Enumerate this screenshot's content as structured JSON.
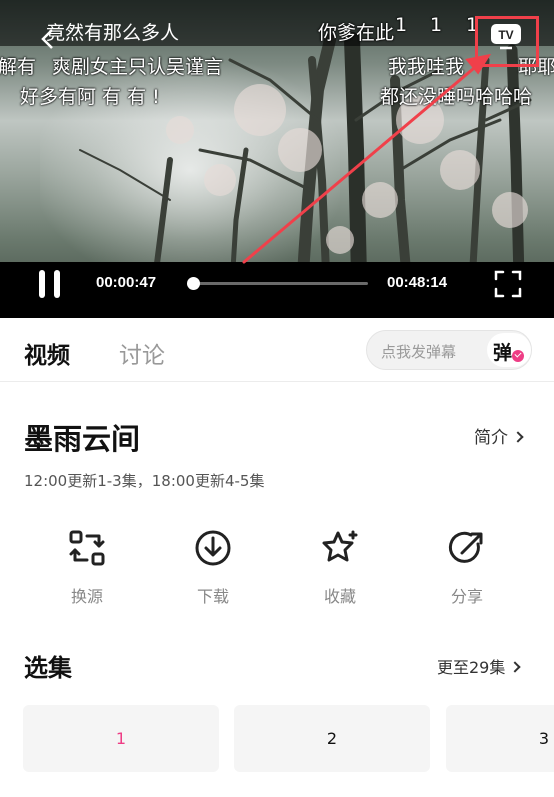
{
  "player": {
    "title": "竟然有那么多人",
    "top_right_text": "你爹在此",
    "top_digits": [
      "1",
      "1"
    ],
    "danmaku_lines": [
      "解有",
      "爽剧女主只认吴谨言",
      "我我哇我",
      "耶耶",
      "好多有阿 有 有 !",
      "都还没睡吗哈哈哈"
    ],
    "current_time": "00:00:47",
    "total_time": "00:48:14",
    "progress_fraction": 0.016,
    "icons": {
      "back": "chevron-left-icon",
      "cast": "tv-cast-icon",
      "pause": "pause-icon",
      "fullscreen": "fullscreen-icon"
    }
  },
  "annotation": {
    "color": "#f0404a"
  },
  "tabs": [
    {
      "label": "视频",
      "active": true
    },
    {
      "label": "讨论",
      "active": false
    }
  ],
  "danmaku_input": {
    "placeholder": "点我发弹幕",
    "toggle_label": "弹",
    "toggle_on": true
  },
  "show": {
    "title": "墨雨云间",
    "intro_label": "简介",
    "update_note": "12:00更新1-3集，18:00更新4-5集"
  },
  "actions": [
    {
      "label": "换源",
      "icon": "switch-source-icon"
    },
    {
      "label": "下载",
      "icon": "download-icon"
    },
    {
      "label": "收藏",
      "icon": "star-icon"
    },
    {
      "label": "分享",
      "icon": "share-icon"
    }
  ],
  "episodes_section": {
    "title": "选集",
    "more_label": "更至29集",
    "episodes": [
      {
        "label": "1",
        "active": true
      },
      {
        "label": "2",
        "active": false
      },
      {
        "label": "3",
        "active": false
      }
    ]
  },
  "colors": {
    "accent": "#ee3d85",
    "text": "#111111",
    "muted": "#999999"
  }
}
